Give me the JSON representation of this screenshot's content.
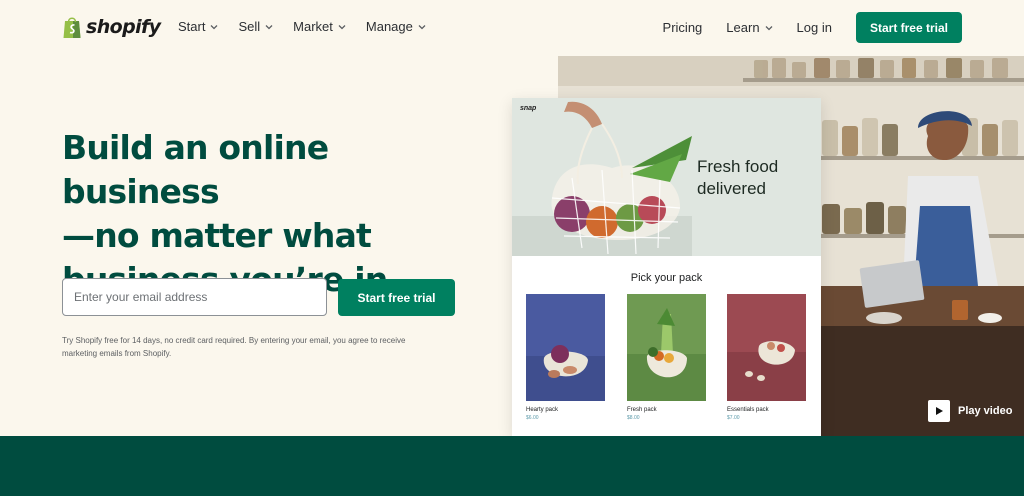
{
  "brand": {
    "name": "shopify"
  },
  "nav": {
    "left_items": [
      {
        "label": "Start",
        "icon": "chevron-down-icon"
      },
      {
        "label": "Sell",
        "icon": "chevron-down-icon"
      },
      {
        "label": "Market",
        "icon": "chevron-down-icon"
      },
      {
        "label": "Manage",
        "icon": "chevron-down-icon"
      }
    ],
    "pricing": "Pricing",
    "learn": "Learn",
    "login": "Log in",
    "cta": "Start free trial"
  },
  "hero": {
    "headline_1": "Build an online business",
    "headline_2": "—no matter what",
    "headline_3": "business you’re in",
    "email_placeholder": "Enter your email address",
    "cta": "Start free trial",
    "disclaimer": "Try Shopify free for 14 days, no credit card required. By entering your email, you agree to receive marketing emails from Shopify."
  },
  "store_preview": {
    "brand": "snap",
    "banner_line_1": "Fresh food",
    "banner_line_2": "delivered",
    "section_title": "Pick your pack",
    "packs": [
      {
        "name": "Hearty pack",
        "price": "$6.00",
        "bg": "#4a5aa0"
      },
      {
        "name": "Fresh pack",
        "price": "$8.00",
        "bg": "#6f9a52"
      },
      {
        "name": "Essentials pack",
        "price": "$7.00",
        "bg": "#9c4a52"
      }
    ]
  },
  "video": {
    "label": "Play video",
    "icon": "play-icon"
  },
  "colors": {
    "brand_green": "#008060",
    "headline": "#004c3f",
    "page_bg": "#fbf7ed"
  }
}
